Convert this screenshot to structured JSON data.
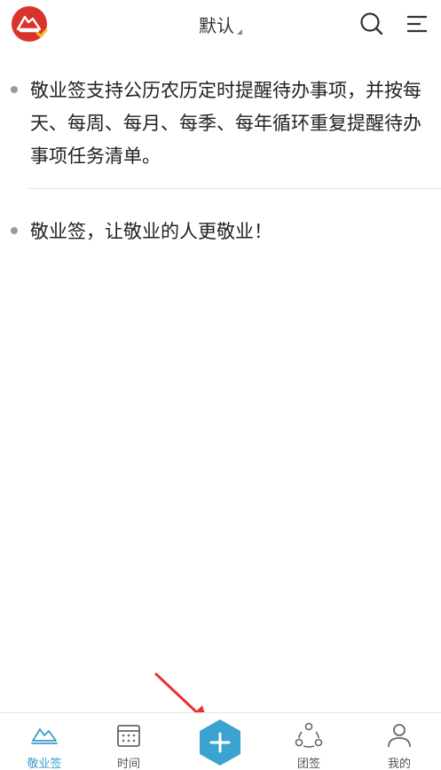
{
  "header": {
    "title": "默认",
    "logo_icon": "app-logo-icon",
    "search_icon": "search-icon",
    "menu_icon": "menu-icon"
  },
  "notes": [
    {
      "text": "敬业签支持公历农历定时提醒待办事项，并按每天、每周、每月、每季、每年循环重复提醒待办事项任务清单。"
    },
    {
      "text": "敬业签，让敬业的人更敬业！"
    }
  ],
  "nav": {
    "tabs": [
      {
        "label": "敬业签",
        "icon": "note-icon",
        "active": true
      },
      {
        "label": "时间",
        "icon": "calendar-icon",
        "active": false
      },
      {
        "label": "团签",
        "icon": "team-icon",
        "active": false
      },
      {
        "label": "我的",
        "icon": "user-icon",
        "active": false
      }
    ],
    "add_icon": "plus-icon"
  },
  "colors": {
    "accent": "#3a9dc8",
    "logo_red": "#d9342b",
    "annotation_arrow": "#e8312a"
  }
}
